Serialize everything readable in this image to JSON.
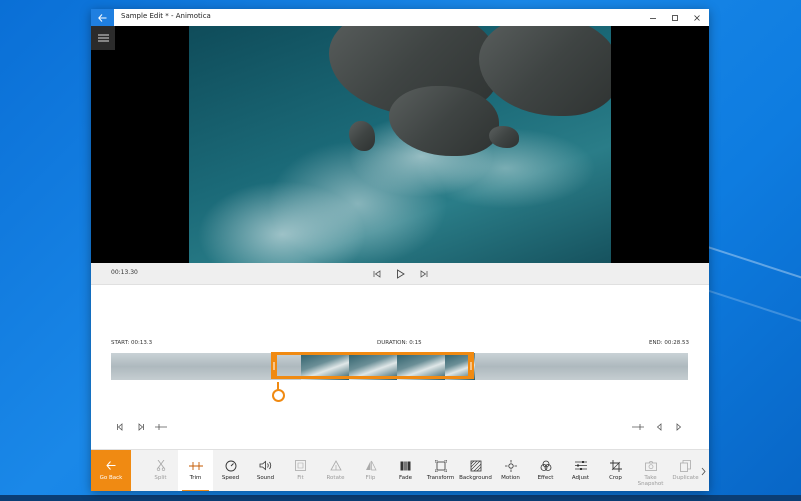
{
  "window": {
    "title": "Sample Edit * - Animotica"
  },
  "player": {
    "timecode": "00:13.30"
  },
  "timeline": {
    "start": "START: 00:13.3",
    "duration": "DURATION: 0:15",
    "end": "END: 00:28.53"
  },
  "toolbar": {
    "go_back": "Go Back",
    "tools": [
      {
        "label": "Split",
        "icon": "scissors-icon",
        "enabled": false
      },
      {
        "label": "Trim",
        "icon": "trim-icon",
        "enabled": true,
        "active": true
      },
      {
        "label": "Speed",
        "icon": "speed-icon",
        "enabled": true
      },
      {
        "label": "Sound",
        "icon": "sound-icon",
        "enabled": true
      },
      {
        "label": "Fit",
        "icon": "fit-icon",
        "enabled": false
      },
      {
        "label": "Rotate",
        "icon": "rotate-icon",
        "enabled": false
      },
      {
        "label": "Flip",
        "icon": "flip-icon",
        "enabled": false
      },
      {
        "label": "Fade",
        "icon": "fade-icon",
        "enabled": true
      },
      {
        "label": "Transform",
        "icon": "transform-icon",
        "enabled": true
      },
      {
        "label": "Background",
        "icon": "background-icon",
        "enabled": true
      },
      {
        "label": "Motion",
        "icon": "motion-icon",
        "enabled": true
      },
      {
        "label": "Effect",
        "icon": "effect-icon",
        "enabled": true
      },
      {
        "label": "Adjust",
        "icon": "adjust-icon",
        "enabled": true
      },
      {
        "label": "Crop",
        "icon": "crop-icon",
        "enabled": true
      },
      {
        "label": "Take Snapshot",
        "icon": "camera-icon",
        "enabled": false
      },
      {
        "label": "Duplicate",
        "icon": "duplicate-icon",
        "enabled": false
      }
    ]
  },
  "colors": {
    "accent": "#f08a12",
    "titlebar_back": "#1f7fe0"
  }
}
